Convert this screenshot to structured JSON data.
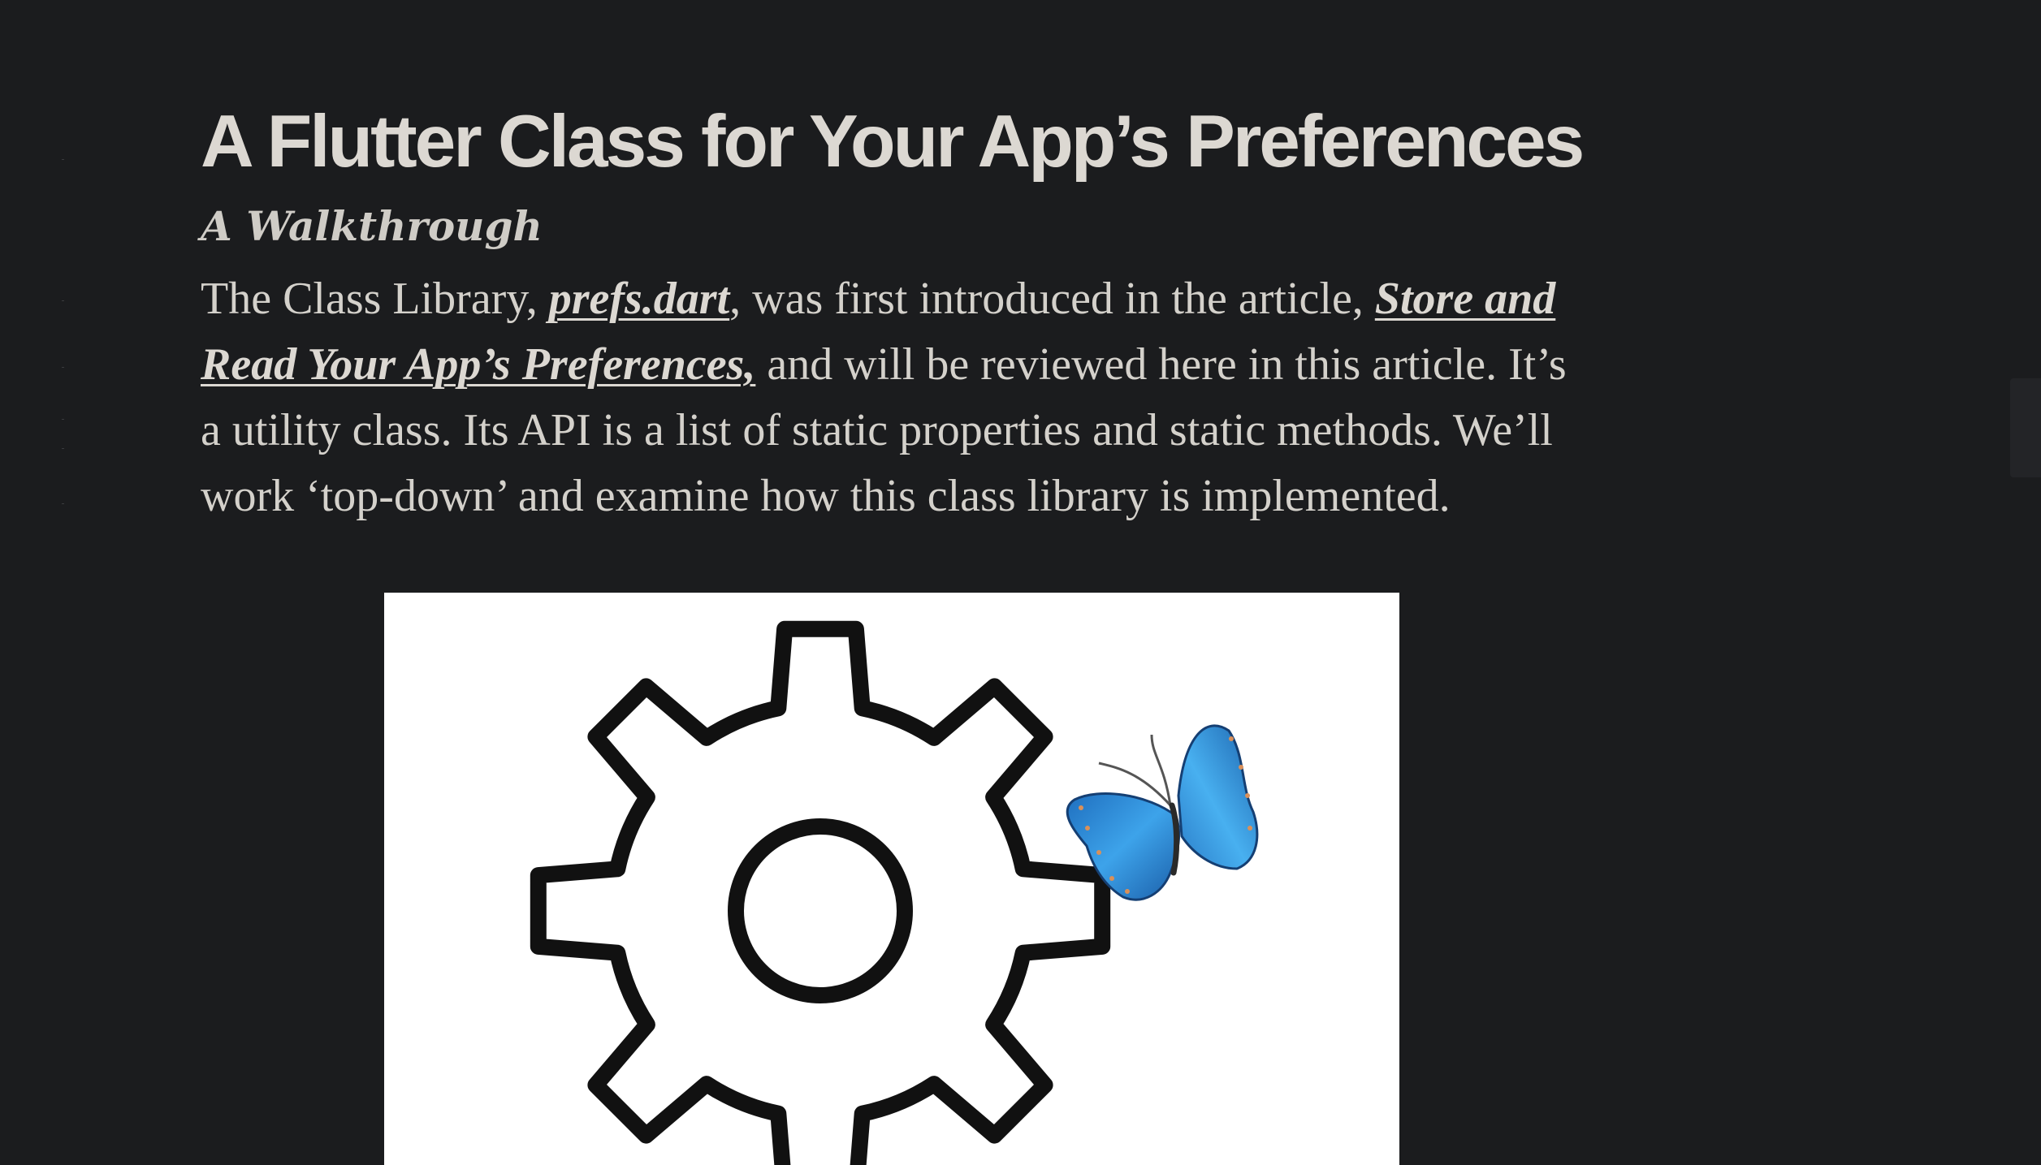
{
  "article": {
    "title": "A Flutter Class for Your App’s Preferences",
    "subtitle": "A Walkthrough",
    "paragraph": {
      "text_1": "The Class Library, ",
      "link_1": "prefs.dart",
      "text_2": ", was first introduced in the article, ",
      "link_2": "Store and Read Your App’s Preferences,",
      "text_3": " and will be reviewed here in this article. It’s a utility class. Its API is a list of static properties and static methods. We’ll work ‘top-down’ and examine how this class library is implemented."
    }
  },
  "figure": {
    "icon_main": "gear-icon",
    "icon_accent": "butterfly-icon",
    "colors": {
      "background": "#ffffff",
      "gear": "#111111",
      "butterfly": "#2f8fd8"
    }
  },
  "theme": {
    "page_background": "#1b1c1e",
    "text": "#d6d3cd"
  }
}
